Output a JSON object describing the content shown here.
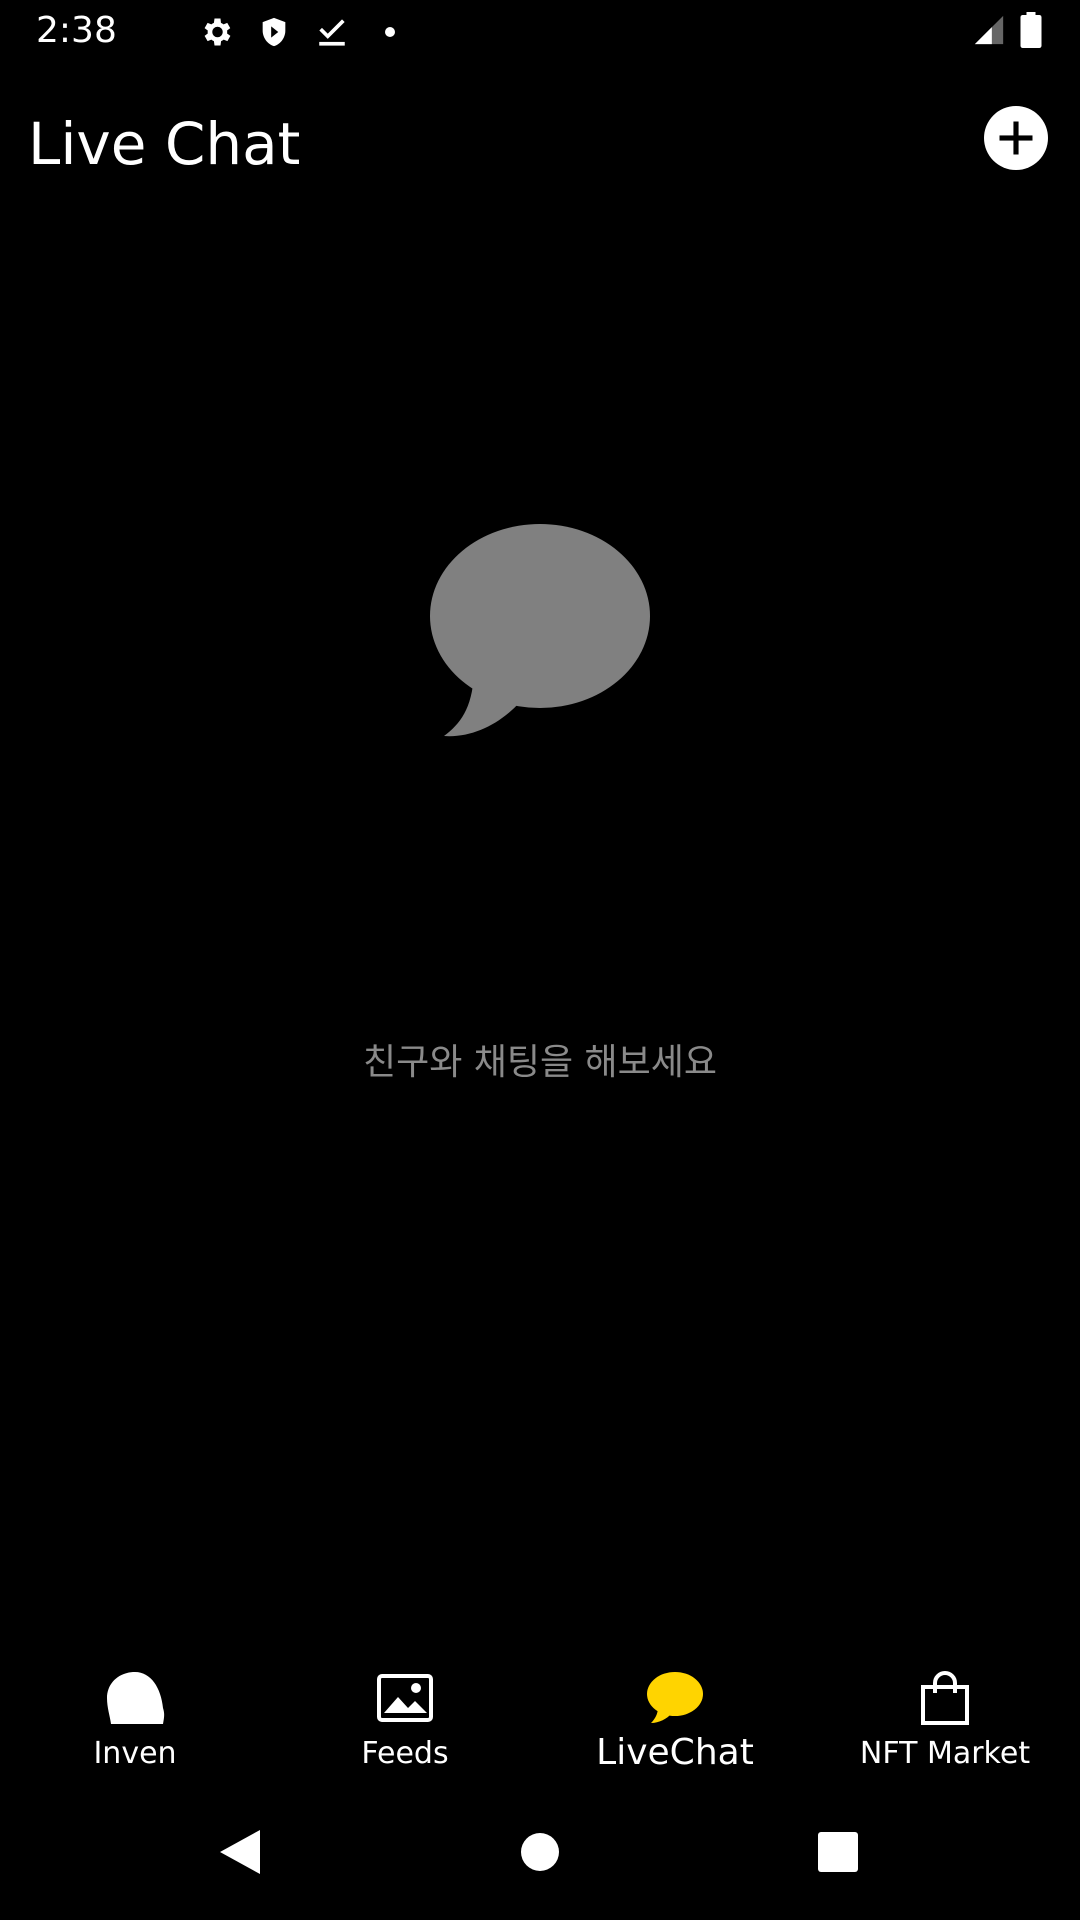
{
  "status_bar": {
    "time": "2:38",
    "left_icons": [
      "gear-icon",
      "shield-icon",
      "download-done-icon",
      "dot-icon"
    ],
    "right_icons": [
      "cell-signal-icon",
      "battery-icon"
    ]
  },
  "header": {
    "title": "Live Chat",
    "add_icon": "plus-circle-icon"
  },
  "empty_state": {
    "icon": "chat-bubble-icon",
    "icon_color": "#808080",
    "message": "친구와 채팅을 해보세요",
    "message_color": "#8a8a8a"
  },
  "bottom_nav": {
    "active_color": "#FFD400",
    "items": [
      {
        "label": "Inven",
        "icon": "bubble-icon",
        "active": false
      },
      {
        "label": "Feeds",
        "icon": "image-icon",
        "active": false
      },
      {
        "label": "LiveChat",
        "icon": "chat-bubble-icon",
        "active": true
      },
      {
        "label": "NFT Market",
        "icon": "shopping-bag-icon",
        "active": false
      }
    ]
  },
  "system_nav": {
    "buttons": [
      "back-icon",
      "home-icon",
      "recents-icon"
    ]
  }
}
